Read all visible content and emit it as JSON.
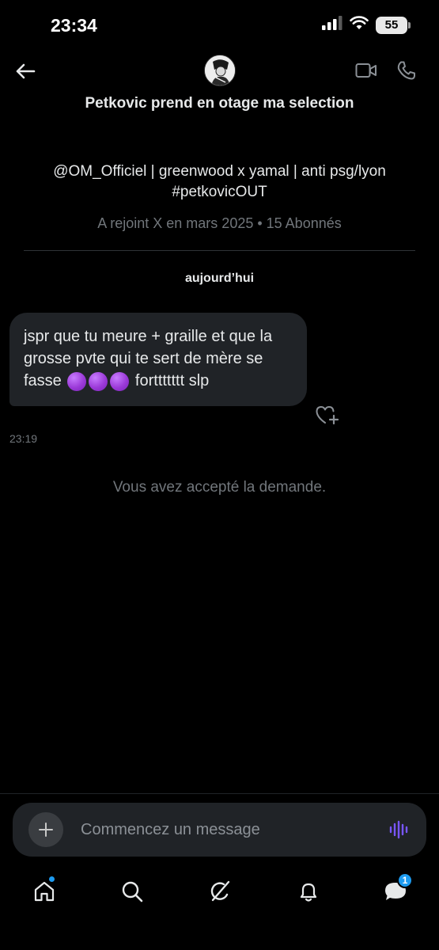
{
  "status_bar": {
    "time": "23:34",
    "battery": "55"
  },
  "header": {
    "title": "Petkovic prend en otage ma selection",
    "back_icon": "arrow-left-icon",
    "video_icon": "video-camera-icon",
    "call_icon": "phone-icon"
  },
  "profile": {
    "bio_line1": "@OM_Officiel | greenwood x yamal | anti psg/lyon",
    "bio_line2": "#petkovicOUT",
    "meta": "A rejoint X en mars 2025 • 15 Abonnés"
  },
  "conversation": {
    "day_label": "aujourd’hui",
    "message": {
      "text_before": "jspr que tu meure + graille et que la grosse pvte qui te sert de mère se fasse ",
      "text_after": " forttttttt slp",
      "emoji": "purple-circle",
      "emoji_count": 3,
      "time": "23:19"
    },
    "system_note": "Vous avez accepté la demande."
  },
  "composer": {
    "placeholder": "Commencez un message"
  },
  "tabbar": {
    "messages_badge": "1"
  },
  "colors": {
    "background": "#000000",
    "bubble": "#202327",
    "muted_text": "#71767b",
    "accent": "#1d9bf0",
    "voice_accent": "#7856ff"
  }
}
